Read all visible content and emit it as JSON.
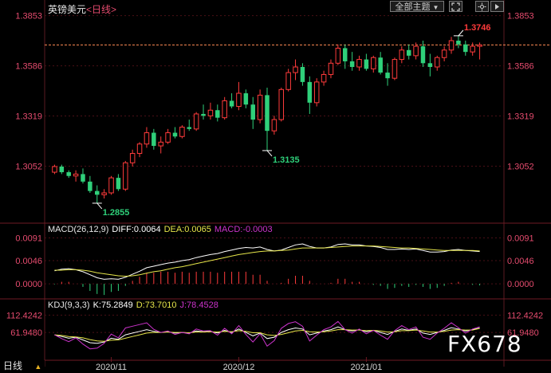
{
  "header": {
    "symbol": "英镑美元",
    "period": "<日线>",
    "theme_button": "全部主题",
    "theme_arrow": "▼"
  },
  "colors": {
    "up": "#ff3b3b",
    "down": "#2fd07a",
    "axis_text": "#e54b6e",
    "grid": "#4a0f16",
    "last_price_line": "#ff8a55",
    "diff_line": "#ffffff",
    "dea_line": "#e6e64a",
    "j_line": "#cc33cc"
  },
  "price_panel": {
    "ylim": [
      1.277,
      1.386
    ],
    "ticks_left": [
      "1.3853",
      "1.3586",
      "1.3319",
      "1.3052"
    ],
    "ticks_right": [
      "1.3853",
      "1.3586",
      "1.3319",
      "1.3052"
    ],
    "tick_values": [
      1.3853,
      1.3586,
      1.3319,
      1.3052
    ],
    "last_price": 1.3697,
    "annotations": [
      {
        "label": "1.3746",
        "value": 1.3746,
        "index": 57,
        "color": "#ff3b3b",
        "dir": "up"
      },
      {
        "label": "1.3135",
        "value": 1.3135,
        "index": 30,
        "color": "#2fd07a",
        "dir": "down"
      },
      {
        "label": "1.2855",
        "value": 1.2855,
        "index": 6,
        "color": "#2fd07a",
        "dir": "down"
      }
    ]
  },
  "x_axis": {
    "labels": [
      {
        "text": "2020/11",
        "index": 8
      },
      {
        "text": "2020/12",
        "index": 26
      },
      {
        "text": "2021/01",
        "index": 44
      }
    ]
  },
  "macd_panel": {
    "params": "MACD(26,12,9)",
    "diff_label": "DIFF:0.0064",
    "dea_label": "DEA:0.0065",
    "macd_label": "MACD:-0.0003",
    "ticks_left": [
      "0.0091",
      "0.0046",
      "0.0000"
    ],
    "ticks_right": [
      "0.0091",
      "0.0046",
      "0.0000"
    ],
    "tick_values": [
      0.0091,
      0.0046,
      0.0
    ],
    "ylim": [
      -0.0025,
      0.0098
    ]
  },
  "kdj_panel": {
    "params": "KDJ(9,3,3)",
    "k_label": "K:75.2849",
    "d_label": "D:73.7010",
    "j_label": "J:78.4528",
    "ticks_left": [
      "112.4242",
      "61.9480"
    ],
    "ticks_right": [
      "112.4242",
      "61.9480"
    ],
    "tick_values": [
      112.4242,
      61.948
    ],
    "ylim": [
      -10,
      125
    ]
  },
  "footer": {
    "period_label": "日线",
    "arrow": "▲"
  },
  "watermark": "FX678",
  "chart_data": {
    "type": "candlestick",
    "series": [
      {
        "name": "OHLC",
        "candles": [
          [
            1.302,
            1.306,
            1.301,
            1.305
          ],
          [
            1.305,
            1.306,
            1.301,
            1.302
          ],
          [
            1.302,
            1.303,
            1.299,
            1.3
          ],
          [
            1.3,
            1.303,
            1.297,
            1.301
          ],
          [
            1.301,
            1.304,
            1.296,
            1.297
          ],
          [
            1.297,
            1.3,
            1.291,
            1.292
          ],
          [
            1.292,
            1.295,
            1.2855,
            1.29
          ],
          [
            1.29,
            1.293,
            1.288,
            1.291
          ],
          [
            1.291,
            1.3,
            1.29,
            1.299
          ],
          [
            1.299,
            1.301,
            1.292,
            1.293
          ],
          [
            1.293,
            1.308,
            1.292,
            1.307
          ],
          [
            1.307,
            1.314,
            1.305,
            1.312
          ],
          [
            1.312,
            1.318,
            1.31,
            1.317
          ],
          [
            1.317,
            1.326,
            1.315,
            1.323
          ],
          [
            1.323,
            1.325,
            1.314,
            1.316
          ],
          [
            1.316,
            1.321,
            1.312,
            1.318
          ],
          [
            1.318,
            1.325,
            1.317,
            1.323
          ],
          [
            1.323,
            1.326,
            1.32,
            1.321
          ],
          [
            1.321,
            1.327,
            1.32,
            1.326
          ],
          [
            1.326,
            1.33,
            1.324,
            1.325
          ],
          [
            1.325,
            1.334,
            1.324,
            1.333
          ],
          [
            1.333,
            1.338,
            1.33,
            1.332
          ],
          [
            1.332,
            1.339,
            1.33,
            1.335
          ],
          [
            1.335,
            1.338,
            1.329,
            1.331
          ],
          [
            1.331,
            1.342,
            1.33,
            1.34
          ],
          [
            1.34,
            1.344,
            1.336,
            1.337
          ],
          [
            1.337,
            1.35,
            1.335,
            1.344
          ],
          [
            1.344,
            1.346,
            1.336,
            1.338
          ],
          [
            1.338,
            1.342,
            1.325,
            1.33
          ],
          [
            1.33,
            1.346,
            1.328,
            1.343
          ],
          [
            1.343,
            1.347,
            1.3135,
            1.324
          ],
          [
            1.324,
            1.332,
            1.322,
            1.33
          ],
          [
            1.33,
            1.347,
            1.329,
            1.346
          ],
          [
            1.346,
            1.357,
            1.345,
            1.355
          ],
          [
            1.355,
            1.362,
            1.351,
            1.358
          ],
          [
            1.358,
            1.36,
            1.348,
            1.35
          ],
          [
            1.35,
            1.353,
            1.333,
            1.339
          ],
          [
            1.339,
            1.352,
            1.337,
            1.35
          ],
          [
            1.35,
            1.356,
            1.348,
            1.354
          ],
          [
            1.354,
            1.362,
            1.352,
            1.36
          ],
          [
            1.36,
            1.37,
            1.359,
            1.368
          ],
          [
            1.368,
            1.37,
            1.357,
            1.361
          ],
          [
            1.361,
            1.366,
            1.356,
            1.358
          ],
          [
            1.358,
            1.364,
            1.356,
            1.362
          ],
          [
            1.362,
            1.365,
            1.356,
            1.357
          ],
          [
            1.357,
            1.364,
            1.355,
            1.363
          ],
          [
            1.363,
            1.366,
            1.354,
            1.355
          ],
          [
            1.355,
            1.36,
            1.348,
            1.352
          ],
          [
            1.352,
            1.363,
            1.351,
            1.362
          ],
          [
            1.362,
            1.369,
            1.36,
            1.367
          ],
          [
            1.367,
            1.37,
            1.362,
            1.364
          ],
          [
            1.364,
            1.371,
            1.362,
            1.369
          ],
          [
            1.369,
            1.372,
            1.358,
            1.36
          ],
          [
            1.36,
            1.365,
            1.353,
            1.358
          ],
          [
            1.358,
            1.364,
            1.356,
            1.363
          ],
          [
            1.363,
            1.369,
            1.361,
            1.367
          ],
          [
            1.367,
            1.374,
            1.365,
            1.372
          ],
          [
            1.372,
            1.3746,
            1.368,
            1.37
          ],
          [
            1.37,
            1.372,
            1.364,
            1.366
          ],
          [
            1.366,
            1.371,
            1.364,
            1.369
          ],
          [
            1.369,
            1.371,
            1.362,
            1.3697
          ]
        ]
      },
      {
        "name": "DIFF",
        "values": [
          0.0026,
          0.0029,
          0.003,
          0.0028,
          0.0024,
          0.0018,
          0.0012,
          0.0009,
          0.001,
          0.0009,
          0.0013,
          0.0019,
          0.0025,
          0.0032,
          0.0035,
          0.0038,
          0.0041,
          0.0043,
          0.0046,
          0.0048,
          0.0052,
          0.0055,
          0.0058,
          0.006,
          0.0064,
          0.0067,
          0.007,
          0.0072,
          0.0071,
          0.0073,
          0.0068,
          0.0065,
          0.0067,
          0.0072,
          0.0077,
          0.0079,
          0.0074,
          0.0071,
          0.0071,
          0.0073,
          0.0078,
          0.0079,
          0.0077,
          0.0077,
          0.0075,
          0.0074,
          0.0072,
          0.0068,
          0.0068,
          0.0069,
          0.0068,
          0.0069,
          0.0066,
          0.0063,
          0.0063,
          0.0064,
          0.0067,
          0.0068,
          0.0066,
          0.0065,
          0.0064
        ]
      },
      {
        "name": "DEA",
        "values": [
          0.0027,
          0.0027,
          0.0028,
          0.0028,
          0.0027,
          0.0025,
          0.0022,
          0.002,
          0.0018,
          0.0016,
          0.0015,
          0.0016,
          0.0018,
          0.0021,
          0.0024,
          0.0026,
          0.0029,
          0.0032,
          0.0034,
          0.0037,
          0.004,
          0.0043,
          0.0046,
          0.0049,
          0.0052,
          0.0055,
          0.0058,
          0.006,
          0.0062,
          0.0064,
          0.0065,
          0.0065,
          0.0066,
          0.0067,
          0.0069,
          0.0071,
          0.0071,
          0.0071,
          0.0071,
          0.0072,
          0.0073,
          0.0074,
          0.0075,
          0.0075,
          0.0075,
          0.0075,
          0.0074,
          0.0073,
          0.0072,
          0.0071,
          0.0071,
          0.007,
          0.0069,
          0.0068,
          0.0067,
          0.0066,
          0.0066,
          0.0066,
          0.0066,
          0.0066,
          0.0065
        ]
      },
      {
        "name": "MACD",
        "values": [
          -0.0001,
          0.0004,
          0.0004,
          0.0,
          -0.0006,
          -0.0014,
          -0.002,
          -0.0022,
          -0.0016,
          -0.0014,
          -0.0004,
          0.0006,
          0.0014,
          0.0022,
          0.0022,
          0.0024,
          0.0024,
          0.0022,
          0.0024,
          0.0022,
          0.0024,
          0.0024,
          0.0024,
          0.0022,
          0.0024,
          0.0024,
          0.0024,
          0.0024,
          0.0018,
          0.0018,
          0.0006,
          0.0,
          0.0002,
          0.001,
          0.0016,
          0.0016,
          0.0006,
          0.0,
          0.0,
          0.0002,
          0.001,
          0.001,
          0.0004,
          0.0004,
          0.0,
          -0.0002,
          -0.0004,
          -0.001,
          -0.0008,
          -0.0004,
          -0.0006,
          -0.0002,
          -0.0006,
          -0.001,
          -0.0008,
          -0.0004,
          0.0002,
          0.0004,
          0.0,
          -0.0002,
          -0.0003
        ]
      },
      {
        "name": "K",
        "values": [
          55,
          50,
          45,
          48,
          40,
          32,
          30,
          34,
          45,
          42,
          55,
          60,
          65,
          70,
          65,
          62,
          64,
          60,
          62,
          60,
          66,
          64,
          65,
          60,
          68,
          62,
          72,
          62,
          52,
          60,
          44,
          48,
          62,
          70,
          75,
          72,
          55,
          60,
          66,
          70,
          78,
          70,
          66,
          70,
          64,
          68,
          62,
          56,
          65,
          72,
          68,
          72,
          60,
          56,
          62,
          68,
          76,
          72,
          66,
          70,
          75
        ]
      },
      {
        "name": "D",
        "values": [
          55,
          53,
          50,
          49,
          46,
          41,
          37,
          36,
          39,
          40,
          45,
          50,
          55,
          60,
          62,
          62,
          63,
          62,
          62,
          61,
          63,
          63,
          64,
          63,
          65,
          64,
          67,
          65,
          61,
          61,
          55,
          53,
          56,
          61,
          66,
          68,
          64,
          63,
          64,
          66,
          70,
          70,
          69,
          69,
          67,
          68,
          66,
          63,
          64,
          67,
          67,
          69,
          66,
          63,
          63,
          65,
          69,
          70,
          69,
          69,
          73.7
        ]
      },
      {
        "name": "J",
        "values": [
          55,
          44,
          35,
          46,
          28,
          14,
          16,
          30,
          57,
          46,
          75,
          80,
          85,
          90,
          71,
          62,
          66,
          56,
          62,
          58,
          72,
          66,
          67,
          54,
          74,
          58,
          82,
          56,
          34,
          58,
          22,
          38,
          74,
          88,
          93,
          80,
          37,
          54,
          70,
          78,
          94,
          70,
          60,
          72,
          58,
          68,
          54,
          42,
          67,
          82,
          70,
          78,
          48,
          42,
          60,
          74,
          90,
          76,
          60,
          72,
          78.5
        ]
      }
    ]
  }
}
